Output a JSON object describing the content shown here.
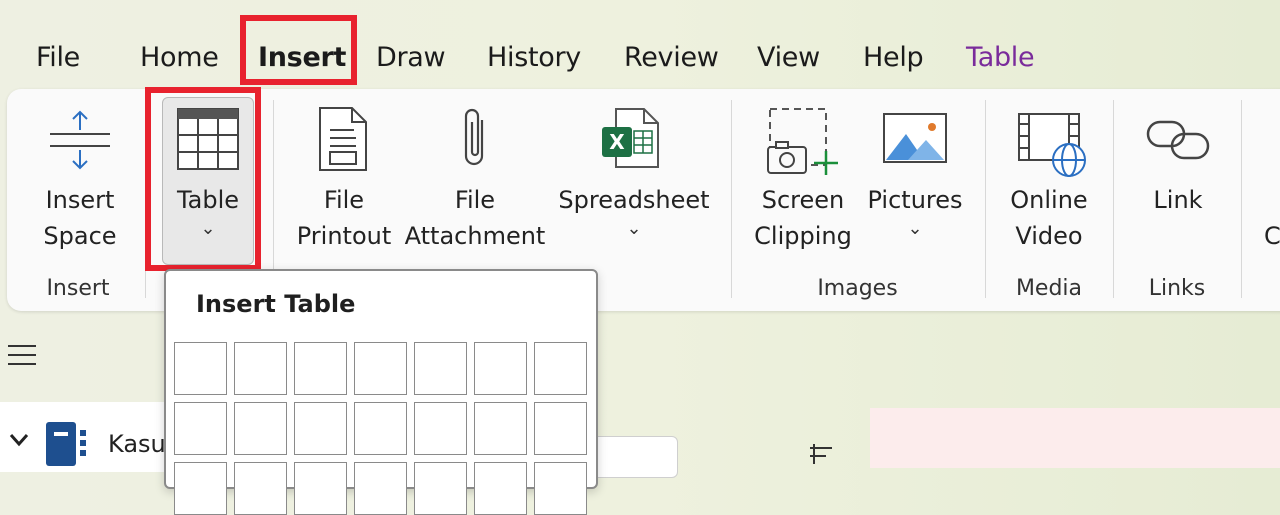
{
  "menu": {
    "file": "File",
    "home": "Home",
    "insert": "Insert",
    "draw": "Draw",
    "history": "History",
    "review": "Review",
    "view": "View",
    "help": "Help",
    "table": "Table"
  },
  "ribbon": {
    "insert_space": {
      "line1": "Insert",
      "line2": "Space",
      "icon": "insert-space-icon"
    },
    "table": {
      "label": "Table",
      "icon": "table-icon"
    },
    "file_printout": {
      "line1": "File",
      "line2": "Printout",
      "icon": "file-printout-icon"
    },
    "file_attachment": {
      "line1": "File",
      "line2": "Attachment",
      "icon": "paperclip-icon"
    },
    "spreadsheet": {
      "label": "Spreadsheet",
      "icon": "excel-icon"
    },
    "screen_clipping": {
      "line1": "Screen",
      "line2": "Clipping",
      "icon": "screen-clipping-icon"
    },
    "pictures": {
      "label": "Pictures",
      "icon": "pictures-icon"
    },
    "online_video": {
      "line1": "Online",
      "line2": "Video",
      "icon": "online-video-icon"
    },
    "link": {
      "label": "Link",
      "icon": "link-icon"
    },
    "chevron": "⌄",
    "groups": {
      "insert": "Insert",
      "images": "Images",
      "media": "Media",
      "links": "Links"
    },
    "overflow_letter": "C"
  },
  "dropdown": {
    "title": "Insert Table"
  },
  "notebook": {
    "name_partial": "Kasu"
  },
  "colors": {
    "highlight": "#e8222e",
    "contextual_tab": "#7a2b9b",
    "excel_green": "#1d7044",
    "picture_blue": "#4a90d9"
  }
}
